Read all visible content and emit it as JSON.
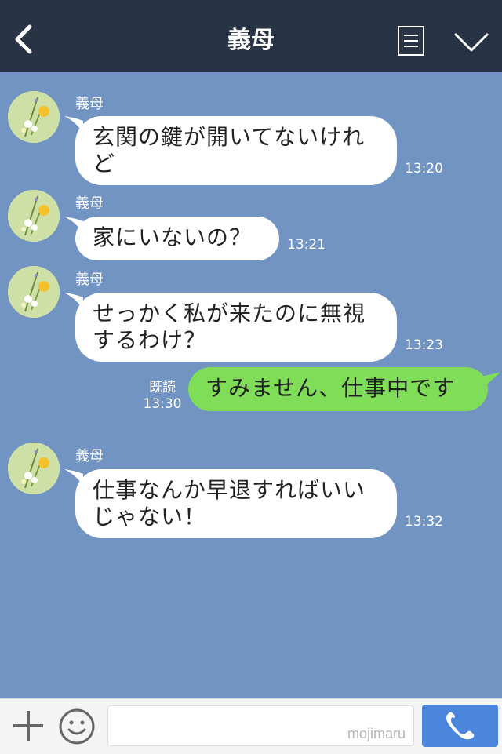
{
  "header": {
    "title": "義母"
  },
  "messages": [
    {
      "sender": "義母",
      "text": "玄関の鍵が開いてないけれ\nど",
      "time": "13:20"
    },
    {
      "sender": "義母",
      "text": "家にいないの？",
      "time": "13:21"
    },
    {
      "sender": "義母",
      "text": "せっかく私が来たのに無視\nするわけ？",
      "time": "13:23"
    },
    {
      "mine": true,
      "read": "既読",
      "time": "13:30",
      "text": "すみません、仕事中です"
    },
    {
      "sender": "義母",
      "text": "仕事なんか早退すればいい\nじゃない！",
      "time": "13:32"
    }
  ],
  "footer": {
    "watermark": "mojimaru"
  },
  "colors": {
    "header": "#283345",
    "background": "#7294c3",
    "my_bubble": "#7fdd58",
    "call_button": "#4b86dc"
  }
}
